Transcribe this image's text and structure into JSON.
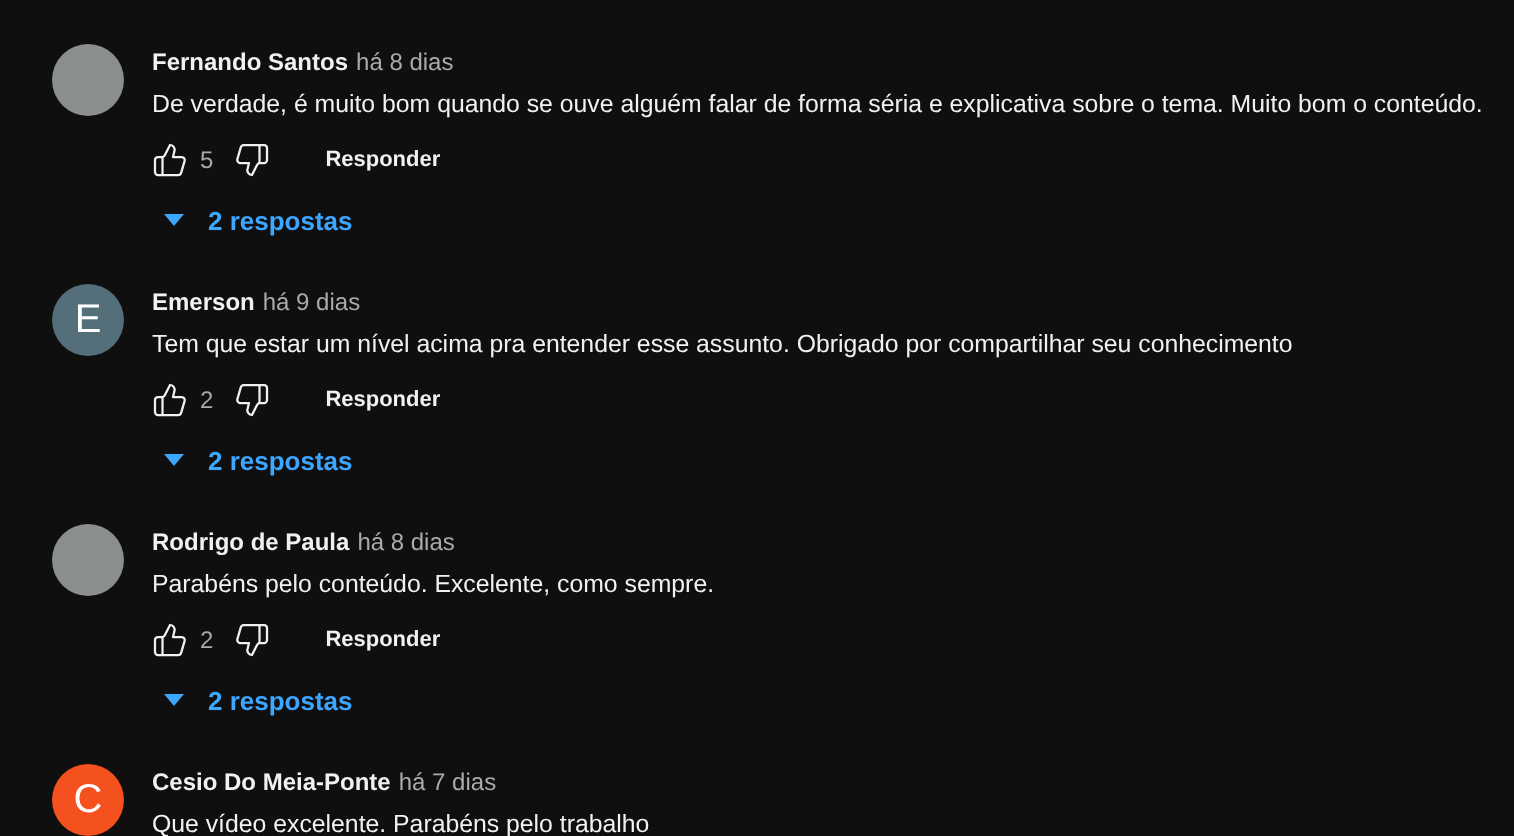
{
  "comments": [
    {
      "author": "Fernando Santos",
      "time": "há 8 dias",
      "text": "De verdade, é muito bom quando se ouve alguém falar de forma séria e explicativa sobre o tema. Muito bom o conteúdo.",
      "avatar": {
        "kind": "photo"
      },
      "likes": "5",
      "reply_label": "Responder",
      "replies": "2 respostas"
    },
    {
      "author": "Emerson",
      "time": "há 9 dias",
      "text": "Tem que estar um nível acima pra entender esse assunto. Obrigado por compartilhar seu conhecimento",
      "avatar": {
        "kind": "letter",
        "letter": "E",
        "color": "#546e7a"
      },
      "likes": "2",
      "reply_label": "Responder",
      "replies": "2 respostas"
    },
    {
      "author": "Rodrigo de Paula",
      "time": "há 8 dias",
      "text": "Parabéns pelo conteúdo. Excelente, como sempre.",
      "avatar": {
        "kind": "photo"
      },
      "likes": "2",
      "reply_label": "Responder",
      "replies": "2 respostas"
    },
    {
      "author": "Cesio Do Meia-Ponte",
      "time": "há 7 dias",
      "text": "Que vídeo excelente. Parabéns pelo trabalho",
      "avatar": {
        "kind": "letter",
        "letter": "C",
        "color": "#f4511e"
      }
    }
  ]
}
